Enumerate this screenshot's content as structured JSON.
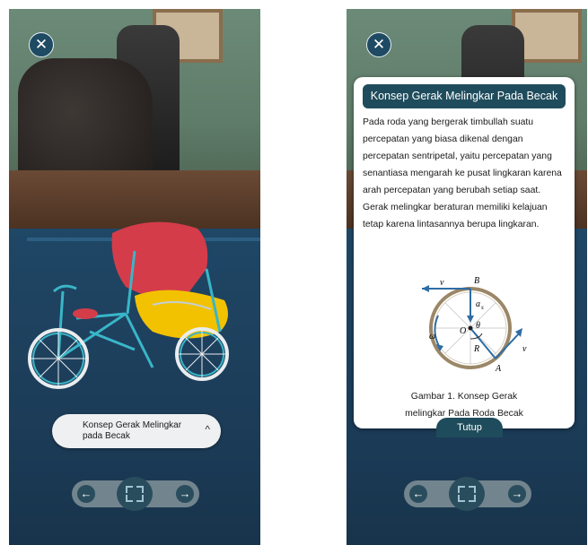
{
  "left_screen": {
    "close_symbol": "✕",
    "info_pill": {
      "label": "Konsep Gerak Melingkar pada Becak",
      "chevron": "^"
    },
    "nav": {
      "prev": "←",
      "next": "→"
    }
  },
  "right_screen": {
    "close_symbol": "✕",
    "card": {
      "title": "Konsep Gerak Melingkar Pada Becak",
      "body": "Pada roda yang bergerak timbullah suatu percepatan yang biasa dikenal dengan percepatan sentripetal, yaitu percepatan yang senantiasa mengarah ke pusat lingkaran karena arah percepatan yang berubah setiap saat. Gerak melingkar beraturan memiliki kelajuan tetap karena lintasannya berupa lingkaran.",
      "figure_labels": {
        "v_top": "v",
        "B": "B",
        "as": "a",
        "as_sub": "s",
        "theta": "θ",
        "omega": "ω",
        "O": "O",
        "R": "R",
        "v_right": "v",
        "A": "A"
      },
      "caption": "Gambar 1. Konsep Gerak melingkar Pada Roda Becak"
    },
    "tutup_label": "Tutup",
    "nav": {
      "prev": "←",
      "next": "→"
    }
  },
  "colors": {
    "accent": "#1f4c5c",
    "becak_canopy": "#d43c4a",
    "becak_body": "#f2c200",
    "frame": "#39b6c8"
  },
  "icons": [
    "close-icon",
    "chevron-up-icon",
    "arrow-left-icon",
    "arrow-right-icon",
    "scan-frame-icon"
  ]
}
